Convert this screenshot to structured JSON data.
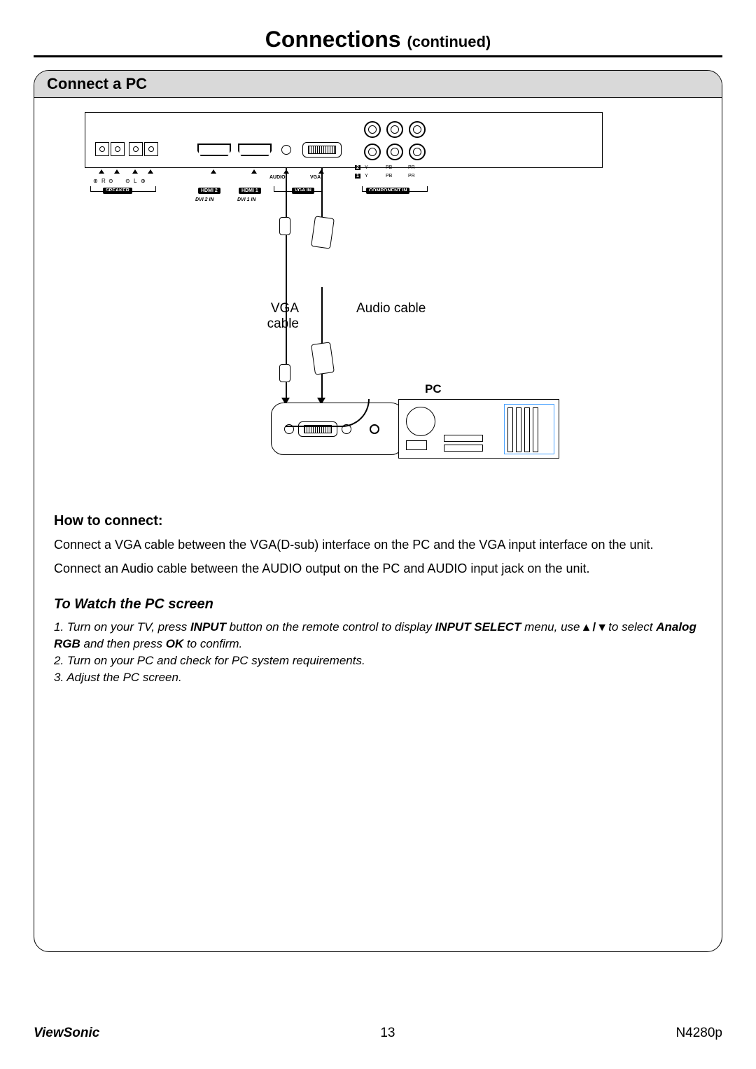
{
  "title": {
    "main": "Connections",
    "suffix": "(continued)"
  },
  "section": {
    "header": "Connect a PC"
  },
  "diagram": {
    "vga_cable": "VGA cable",
    "audio_cable": "Audio cable",
    "pc_label": "PC",
    "ports": {
      "speaker": "SPEAKER",
      "r": "R",
      "l": "L",
      "audio": "AUDIO",
      "vga": "VGA",
      "hdmi2": "HDMI 2",
      "hdmi1": "HDMI 1",
      "vga_in": "VGA IN",
      "component_in": "COMPONENT IN",
      "dvi2": "DVI 2 IN",
      "dvi1": "DVI 1 IN",
      "y": "Y",
      "pb": "PB",
      "pr": "PR",
      "row1": "1",
      "row2": "2"
    }
  },
  "howto": {
    "heading": "How to connect:",
    "line1": "Connect a VGA cable between the VGA(D-sub) interface on the PC and the VGA input interface on the unit.",
    "line2": "Connect an Audio cable between  the AUDIO output on the PC and AUDIO input jack on the unit."
  },
  "watch": {
    "heading": "To Watch the PC screen",
    "step1_a": "1. Turn on your TV, press ",
    "step1_b": "INPUT",
    "step1_c": " button on the remote control to display ",
    "step1_d": "INPUT SELECT",
    "step1_e": " menu, use ",
    "step1_arrows": "▴ / ▾",
    "step1_f": " to select ",
    "step1_g": "Analog RGB",
    "step1_h": " and then press ",
    "step1_i": "OK",
    "step1_j": " to confirm.",
    "step2": "2. Turn on your PC and check for PC system requirements.",
    "step3": "3. Adjust the PC screen."
  },
  "footer": {
    "brand": "ViewSonic",
    "page": "13",
    "model": "N4280p"
  }
}
